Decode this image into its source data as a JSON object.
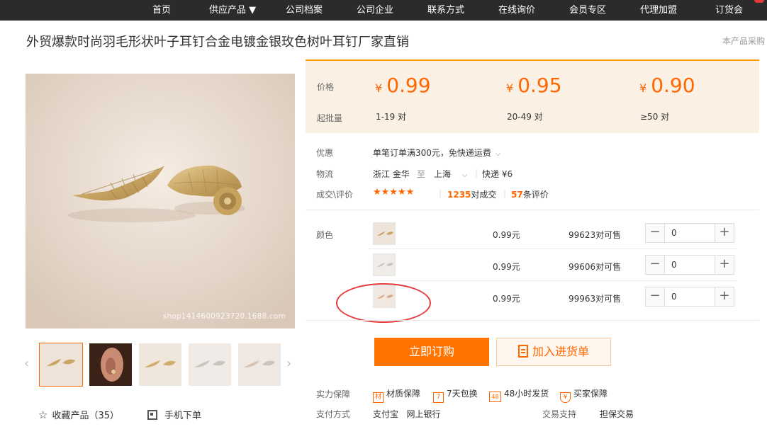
{
  "nav": {
    "items": [
      "首页",
      "供应产品 ▼",
      "公司档案",
      "公司企业",
      "联系方式",
      "在线询价",
      "会员专区",
      "代理加盟",
      "订货会"
    ]
  },
  "product": {
    "title": "外贸爆款时尚羽毛形状叶子耳钉合金电镀金银玫色树叶耳钉厂家直销",
    "side_note": "本产品采购",
    "watermark": "shop1414600923720.1688.com"
  },
  "gallery": {
    "prev_arrow": "‹",
    "next_arrow": "›",
    "favorite_label": "收藏产品（35）",
    "mobile_label": "手机下单"
  },
  "pricing": {
    "price_label": "价格",
    "moq_label": "起批量",
    "currency": "¥",
    "tiers": [
      {
        "price": "0.99",
        "range": "1-19 对"
      },
      {
        "price": "0.95",
        "range": "20-49 对"
      },
      {
        "price": "0.90",
        "range": "≥50 对"
      }
    ]
  },
  "info": {
    "discount_label": "优惠",
    "discount_text": "单笔订单满300元，免快递运费",
    "logistics_label": "物流",
    "origin": "浙江 金华",
    "to_word": "至",
    "destination": "上海",
    "shipping": "快递 ¥6",
    "deals_label": "成交\\评价",
    "stars": "★★★★★",
    "deals_count": "1235",
    "deals_suffix": "对成交",
    "review_count": "57",
    "review_suffix": "条评价"
  },
  "sku": {
    "label": "颜色",
    "rows": [
      {
        "price": "0.99元",
        "stock": "99623对可售",
        "qty": "0"
      },
      {
        "price": "0.99元",
        "stock": "99606对可售",
        "qty": "0"
      },
      {
        "price": "0.99元",
        "stock": "99963对可售",
        "qty": "0"
      }
    ],
    "minus": "−",
    "plus": "+"
  },
  "actions": {
    "buy_now": "立即订购",
    "add_cart": "加入进货单"
  },
  "guarantee": {
    "label": "实力保障",
    "items": [
      {
        "icon": "材",
        "text": "材质保障"
      },
      {
        "icon": "7",
        "text": "7天包换"
      },
      {
        "icon": "48",
        "text": "48小时发货"
      },
      {
        "icon": "¥",
        "text": "买家保障"
      }
    ],
    "payment_label": "支付方式",
    "payment_methods": "支付宝   网上银行",
    "trade_label": "交易支持",
    "trade_value": "担保交易"
  },
  "colors": {
    "accent": "#ff7300",
    "price": "#ff6600",
    "nav_bg": "#2b2b2b",
    "annotation_circle": "#e4393c"
  }
}
